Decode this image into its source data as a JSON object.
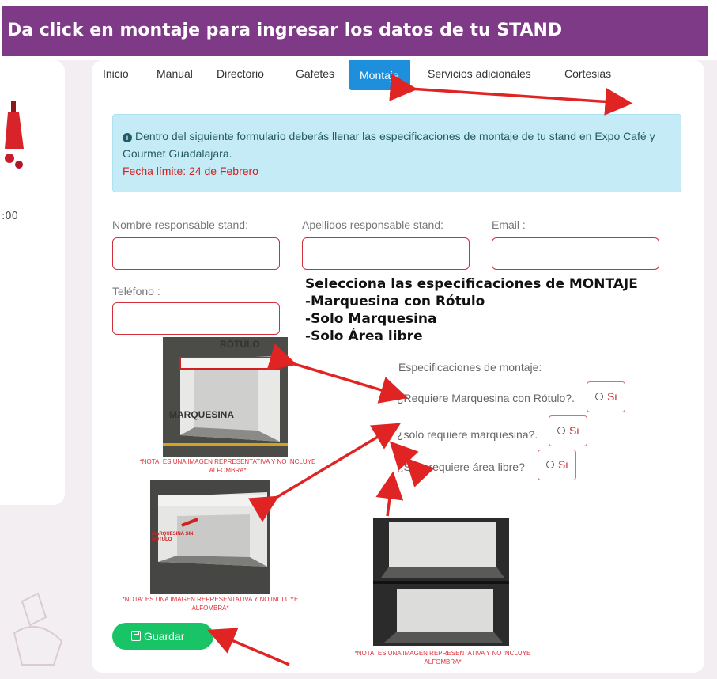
{
  "banner": {
    "title": "Da click en montaje para ingresar los datos de tu STAND"
  },
  "left_panel": {
    "partial_number": ":00"
  },
  "tabs": [
    {
      "label": "Inicio"
    },
    {
      "label": "Manual"
    },
    {
      "label": "Directorio"
    },
    {
      "label": "Gafetes"
    },
    {
      "label": "Montaje",
      "active": true
    },
    {
      "label": "Servicios adicionales"
    },
    {
      "label": "Cortesias"
    }
  ],
  "alert": {
    "text": "Dentro del siguiente formulario deberás llenar las especificaciones de montaje de tu stand en Expo Café y Gourmet Guadalajara.",
    "deadline": "Fecha límite: 24 de Febrero"
  },
  "form": {
    "nombre_label": "Nombre responsable stand:",
    "apellidos_label": "Apellidos responsable stand:",
    "email_label": "Email :",
    "telefono_label": "Teléfono :",
    "nombre_value": "",
    "apellidos_value": "",
    "email_value": "",
    "telefono_value": ""
  },
  "annotation": {
    "line1": "Selecciona las especificaciones de MONTAJE",
    "line2": "-Marquesina con Rótulo",
    "line3": "-Solo Marquesina",
    "line4": "-Solo Área libre"
  },
  "specs": {
    "heading": "Especificaciones de montaje:",
    "q1": "¿Requiere Marquesina con Rótulo?.",
    "q2": "¿solo requiere marquesina?.",
    "q3": "¿Solo requiere área libre?",
    "option_label": "Si"
  },
  "images": {
    "img1_label_top": "RÓTULO",
    "img1_label_bottom": "MARQUESINA",
    "img2_label": "MARQUESINA SIN RÓTULO",
    "note": "*NOTA: ES UNA IMAGEN REPRESENTATIVA Y NO INCLUYE ALFOMBRA*"
  },
  "buttons": {
    "save": "Guardar"
  },
  "colors": {
    "banner": "#7f3a87",
    "tab_active": "#1e8fdc",
    "alert_bg": "#c5ecf6",
    "deadline": "#d81e1e",
    "save": "#19c467",
    "arrow": "#e02424"
  }
}
